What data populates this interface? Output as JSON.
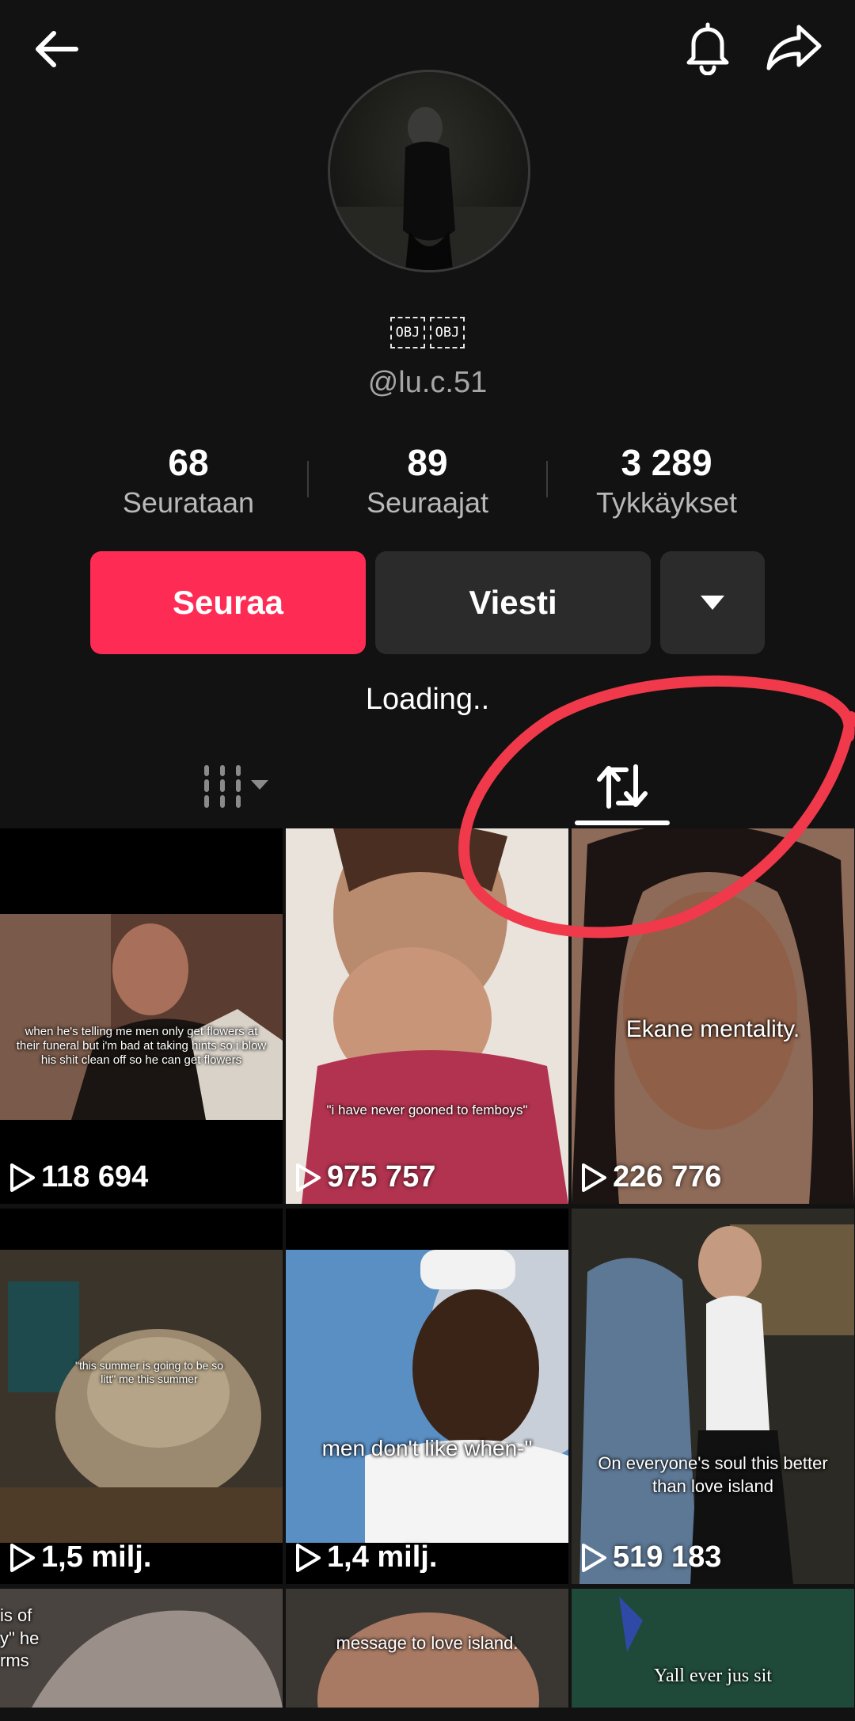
{
  "header": {
    "back_icon": "arrow-left-icon",
    "bell_icon": "bell-icon",
    "share_icon": "share-arrow-icon"
  },
  "profile": {
    "name_placeholders": [
      "OBJ",
      "OBJ"
    ],
    "handle": "@lu.c.51"
  },
  "stats": [
    {
      "value": "68",
      "label": "Seurataan"
    },
    {
      "value": "89",
      "label": "Seuraajat"
    },
    {
      "value": "3 289",
      "label": "Tykkäykset"
    }
  ],
  "actions": {
    "follow_label": "Seuraa",
    "message_label": "Viesti",
    "more_icon": "caret-down-icon"
  },
  "bio": "Loading..",
  "tabs": {
    "videos_icon": "video-grid-icon",
    "reposts_icon": "repost-icon",
    "active": "reposts"
  },
  "colors": {
    "accent": "#FE2C55",
    "bg": "#121212",
    "button_dark": "#2B2B2B",
    "annotation": "#F0394A"
  },
  "videos": [
    {
      "caption": "when he's telling me men only get flowers at their funeral but i'm bad at taking hints so i blow his shit clean off so he can get flowers",
      "views": "118 694"
    },
    {
      "caption": "\"i have never gooned to femboys\"",
      "views": "975 757"
    },
    {
      "caption": "Ekane mentality.",
      "views": "226 776"
    },
    {
      "caption": "\"this summer is going to be so litt\" me this summer",
      "views": "1,5 milj."
    },
    {
      "caption": "men don't like when-\"",
      "views": "1,4 milj."
    },
    {
      "caption": "On everyone's soul this better than love island",
      "views": "519 183"
    },
    {
      "caption": "is of y\" he rms",
      "views": ""
    },
    {
      "caption": "message to love island.",
      "views": ""
    },
    {
      "caption": "Yall ever jus sit",
      "views": ""
    }
  ]
}
